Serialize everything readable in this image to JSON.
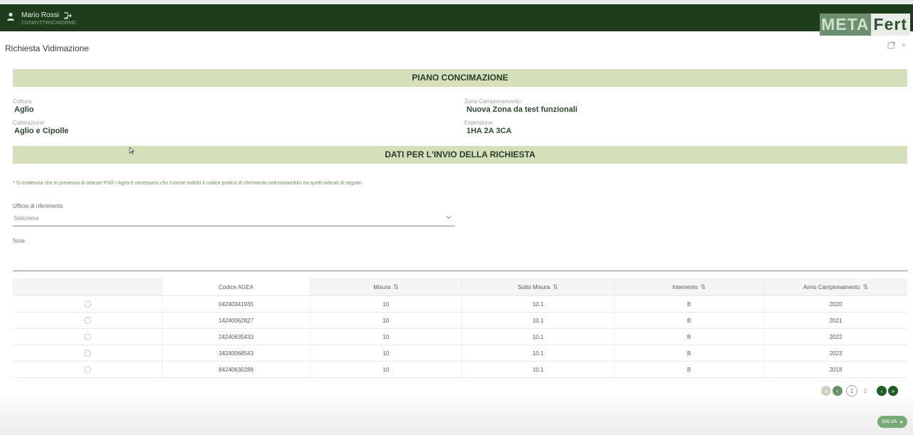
{
  "topbar": {
    "user_name": "Mario Rossi",
    "user_code": "CNSMVTTR0CM00RMC",
    "user_icon": "user-icon",
    "logout_icon": "logout-icon",
    "logo_meta": "META",
    "logo_fert": "Fert"
  },
  "header": {
    "title": "Richiesta Vidimazione",
    "expand_icon": "expand-icon",
    "close_icon": "close-icon",
    "close_label": "×"
  },
  "piano": {
    "section_title": "PIANO CONCIMAZIONE",
    "coltura_label": "Coltura:",
    "coltura_value": "Aglio",
    "coltivazione_label": "Coltivazione:",
    "coltivazione_value": "Aglio e Cipolle",
    "zona_label": "Zona Campionamento:",
    "zona_value": "Nuova Zona da test funzionali",
    "estensione_label": "Estensione:",
    "estensione_value": "1HA 2A 3CA"
  },
  "richiesta": {
    "section_title": "DATI PER L'INVIO DELLA RICHIESTA",
    "note_text": "* Si evidenzia che in presenza di istanze PSR / Agea è necessario che l'utente indichi il codice pratica di riferimento selezionandolo tra quelli indicati di seguito",
    "ufficio_label": "Ufficio di riferimento",
    "ufficio_placeholder": "Seleziona",
    "note_label": "Note"
  },
  "table": {
    "headers": {
      "select": "",
      "codice": "Codice AGEA",
      "misura": "Misura",
      "sotto_misura": "Sotto Misura",
      "intervento": "Intervento",
      "anno": "Anno Campionamento"
    },
    "sort_glyph": "⇅",
    "rows": [
      {
        "codice": "04240341935",
        "misura": "10",
        "sotto_misura": "10.1",
        "intervento": "B",
        "anno": "2020"
      },
      {
        "codice": "14240062827",
        "misura": "10",
        "sotto_misura": "10.1",
        "intervento": "B",
        "anno": "2021"
      },
      {
        "codice": "24240635433",
        "misura": "10",
        "sotto_misura": "10.1",
        "intervento": "B",
        "anno": "2022"
      },
      {
        "codice": "34240068543",
        "misura": "10",
        "sotto_misura": "10.1",
        "intervento": "B",
        "anno": "2023"
      },
      {
        "codice": "84240630289",
        "misura": "10",
        "sotto_misura": "10.1",
        "intervento": "B",
        "anno": "2018"
      }
    ]
  },
  "pagination": {
    "first": "«",
    "prev": "‹",
    "current": "1",
    "page2": "2",
    "next": "›",
    "last": "»"
  },
  "footer": {
    "save_label": "SALVA",
    "save_icon": "arrow-right-icon",
    "save_arrow": "➜"
  },
  "colors": {
    "topbar": "#1d3d1d",
    "band": "#d3e0b9",
    "accent": "#1f5d22",
    "save_button": "#78aa74"
  }
}
